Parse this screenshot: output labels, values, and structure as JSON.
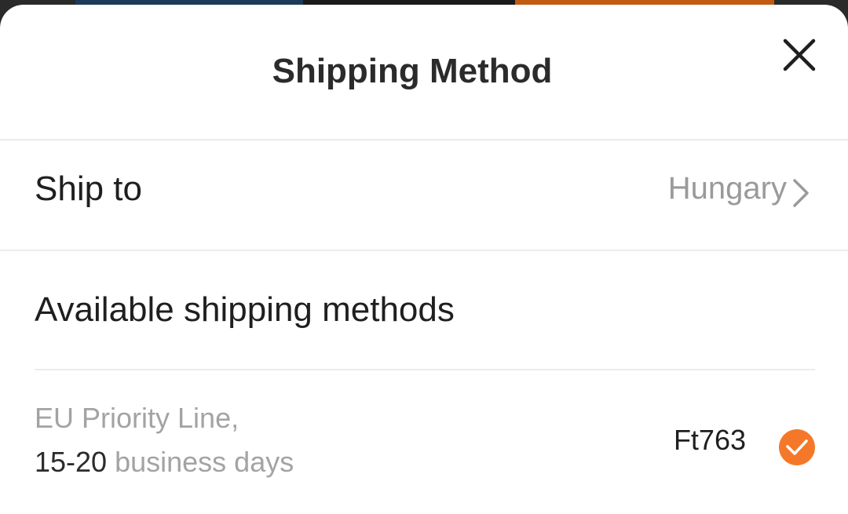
{
  "header": {
    "title": "Shipping Method",
    "close_icon": "close-icon"
  },
  "ship_to": {
    "label": "Ship to",
    "value": "Hungary",
    "icon": "chevron-right-icon"
  },
  "available": {
    "title": "Available shipping methods",
    "methods": [
      {
        "name": "EU Priority Line,",
        "days_range": "15-20",
        "days_unit": "business days",
        "price": "Ft763",
        "selected": true,
        "icon": "check-circle-icon"
      }
    ]
  },
  "colors": {
    "accent": "#f5782a",
    "title_text": "#2b2b2b",
    "muted_text": "#9a9a9a",
    "divider": "#ececec"
  }
}
